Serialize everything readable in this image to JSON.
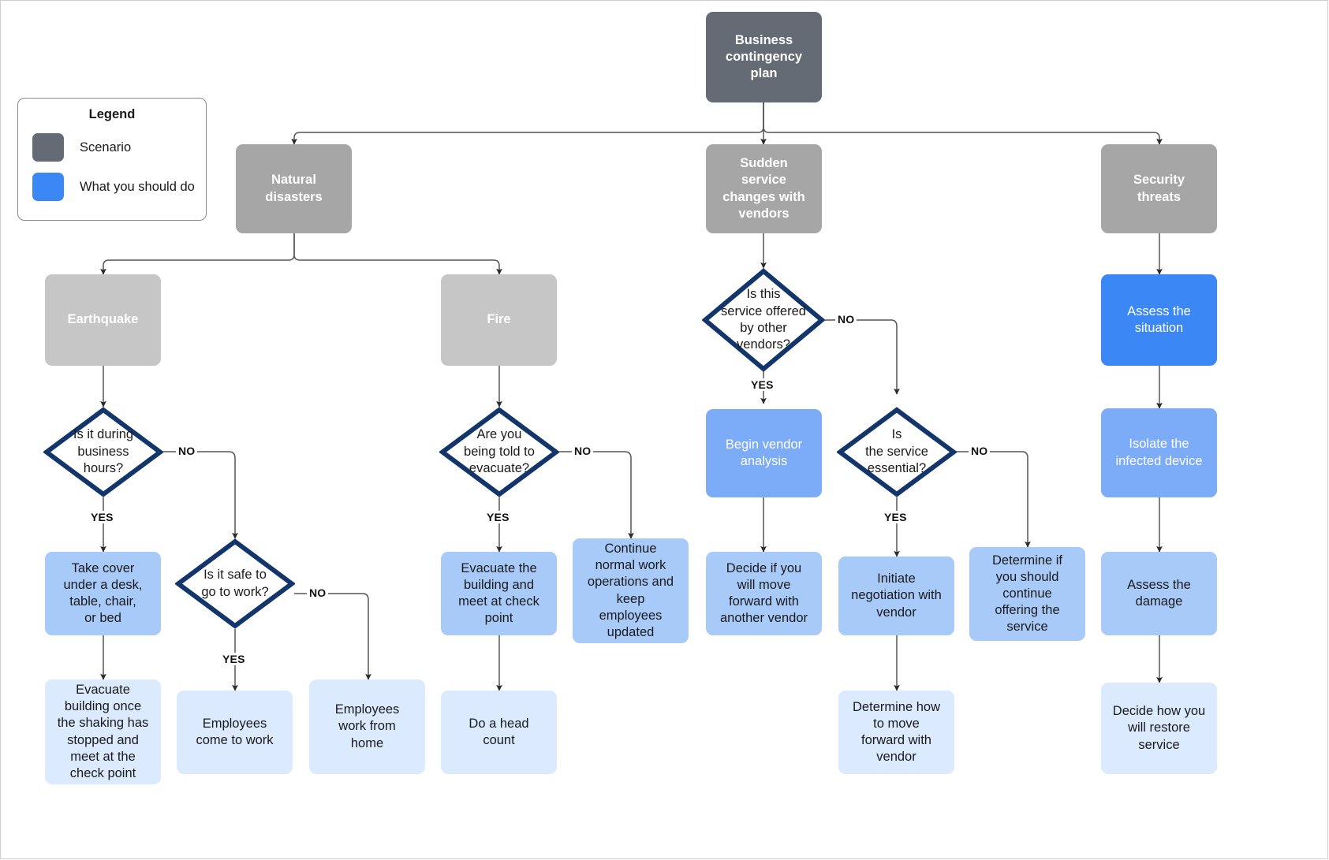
{
  "legend": {
    "title": "Legend",
    "items": [
      {
        "label": "Scenario",
        "color": "#646b74"
      },
      {
        "label": "What you should do",
        "color": "#3b87f5"
      }
    ]
  },
  "colors": {
    "scenario_root": "#646b74",
    "scenario": "#a6a6a6",
    "scenario_light": "#c6c6c6",
    "action_strong": "#3b87f5",
    "action_mid": "#7cabf7",
    "action": "#a8caf9",
    "action_lite": "#dbeafe",
    "decision_border": "#12366b",
    "connector": "#555555"
  },
  "nodes": {
    "root": "Business\ncontingency\nplan",
    "natural_disasters": "Natural\ndisasters",
    "sudden_service": "Sudden\nservice\nchanges with\nvendors",
    "security_threats": "Security\nthreats",
    "earthquake": "Earthquake",
    "fire": "Fire",
    "q_business_hours": "Is it during\nbusiness\nhours?",
    "q_safe_to_work": "Is it safe to\ngo to work?",
    "a_take_cover": "Take cover\nunder a desk,\ntable, chair,\nor bed",
    "a_evacuate_after_shaking": "Evacuate\nbuilding once\nthe shaking has\nstopped and\nmeet at the\ncheck point",
    "a_employees_come": "Employees\ncome to work",
    "a_employees_home": "Employees\nwork from\nhome",
    "q_told_evacuate": "Are you\nbeing told to\nevacuate?",
    "a_evacuate_building": "Evacuate the\nbuilding and\nmeet at check\npoint",
    "a_head_count": "Do a head\ncount",
    "a_continue_normal": "Continue\nnormal work\noperations and\nkeep\nemployees\nupdated",
    "q_other_vendors": "Is this\nservice offered\nby other\nvendors?",
    "a_begin_vendor_analysis": "Begin vendor\nanalysis",
    "a_decide_move_forward": "Decide if you\nwill move\nforward with\nanother vendor",
    "q_service_essential": "Is\nthe service\nessential?",
    "a_initiate_negotiation": "Initiate\nnegotiation with\nvendor",
    "a_determine_how_move": "Determine how\nto move\nforward with\nvendor",
    "a_determine_continue": "Determine if\nyou should\ncontinue\noffering the\nservice",
    "a_assess_situation": "Assess the\nsituation",
    "a_isolate_device": "Isolate the\ninfected device",
    "a_assess_damage": "Assess the\ndamage",
    "a_restore_service": "Decide how you\nwill restore\nservice"
  },
  "edge_labels": {
    "eq_no": "NO",
    "eq_yes": "YES",
    "safe_no": "NO",
    "safe_yes": "YES",
    "fire_no": "NO",
    "fire_yes": "YES",
    "vendors_no": "NO",
    "vendors_yes": "YES",
    "essential_no": "NO",
    "essential_yes": "YES"
  }
}
